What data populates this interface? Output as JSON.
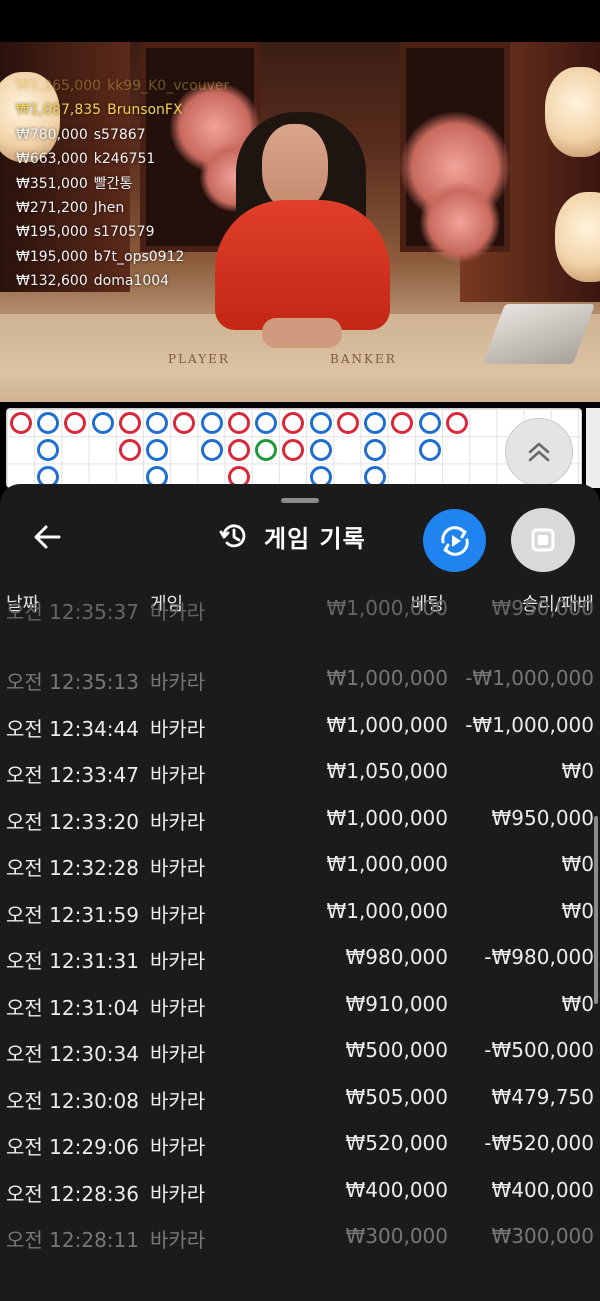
{
  "leaderboard": [
    {
      "amount": "₩1,365,000",
      "name": "kk99_K0_vcouver"
    },
    {
      "amount": "₩1,087,835",
      "name": "BrunsonFX"
    },
    {
      "amount": "₩780,000",
      "name": "s57867"
    },
    {
      "amount": "₩663,000",
      "name": "k246751"
    },
    {
      "amount": "₩351,000",
      "name": "빨간통"
    },
    {
      "amount": "₩271,200",
      "name": "Jhen"
    },
    {
      "amount": "₩195,000",
      "name": "s170579"
    },
    {
      "amount": "₩195,000",
      "name": "b7t_ops0912"
    },
    {
      "amount": "₩132,600",
      "name": "doma1004"
    }
  ],
  "table_labels": {
    "player": "PLAYER",
    "banker": "BANKER"
  },
  "roadmap": {
    "colors": {
      "banker": "#1e6fd0",
      "player": "#d8283a",
      "tie": "#1f9a3a"
    }
  },
  "panel": {
    "title": "게임 기록",
    "icons": {
      "back": "arrow-left-icon",
      "history": "history-clock-icon",
      "video": "video-replay-icon",
      "stop": "stop-icon",
      "expand": "chevron-up-double-icon"
    },
    "accent_color": "#1f83f0",
    "columns": {
      "date": "날짜",
      "game": "게임",
      "bet": "베팅",
      "result": "승리/패배"
    },
    "partial_top_row": {
      "date": "오전 12:35:37",
      "game": "바카라",
      "bet": "₩1,000,000",
      "result": "₩950,000"
    },
    "rows": [
      {
        "date": "오전 12:35:13",
        "game": "바카라",
        "bet": "₩1,000,000",
        "result": "-₩1,000,000"
      },
      {
        "date": "오전 12:34:44",
        "game": "바카라",
        "bet": "₩1,000,000",
        "result": "-₩1,000,000"
      },
      {
        "date": "오전 12:33:47",
        "game": "바카라",
        "bet": "₩1,050,000",
        "result": "₩0"
      },
      {
        "date": "오전 12:33:20",
        "game": "바카라",
        "bet": "₩1,000,000",
        "result": "₩950,000"
      },
      {
        "date": "오전 12:32:28",
        "game": "바카라",
        "bet": "₩1,000,000",
        "result": "₩0"
      },
      {
        "date": "오전 12:31:59",
        "game": "바카라",
        "bet": "₩1,000,000",
        "result": "₩0"
      },
      {
        "date": "오전 12:31:31",
        "game": "바카라",
        "bet": "₩980,000",
        "result": "-₩980,000"
      },
      {
        "date": "오전 12:31:04",
        "game": "바카라",
        "bet": "₩910,000",
        "result": "₩0"
      },
      {
        "date": "오전 12:30:34",
        "game": "바카라",
        "bet": "₩500,000",
        "result": "-₩500,000"
      },
      {
        "date": "오전 12:30:08",
        "game": "바카라",
        "bet": "₩505,000",
        "result": "₩479,750"
      },
      {
        "date": "오전 12:29:06",
        "game": "바카라",
        "bet": "₩520,000",
        "result": "-₩520,000"
      },
      {
        "date": "오전 12:28:36",
        "game": "바카라",
        "bet": "₩400,000",
        "result": "₩400,000"
      },
      {
        "date": "오전 12:28:11",
        "game": "바카라",
        "bet": "₩300,000",
        "result": "₩300,000"
      }
    ]
  }
}
